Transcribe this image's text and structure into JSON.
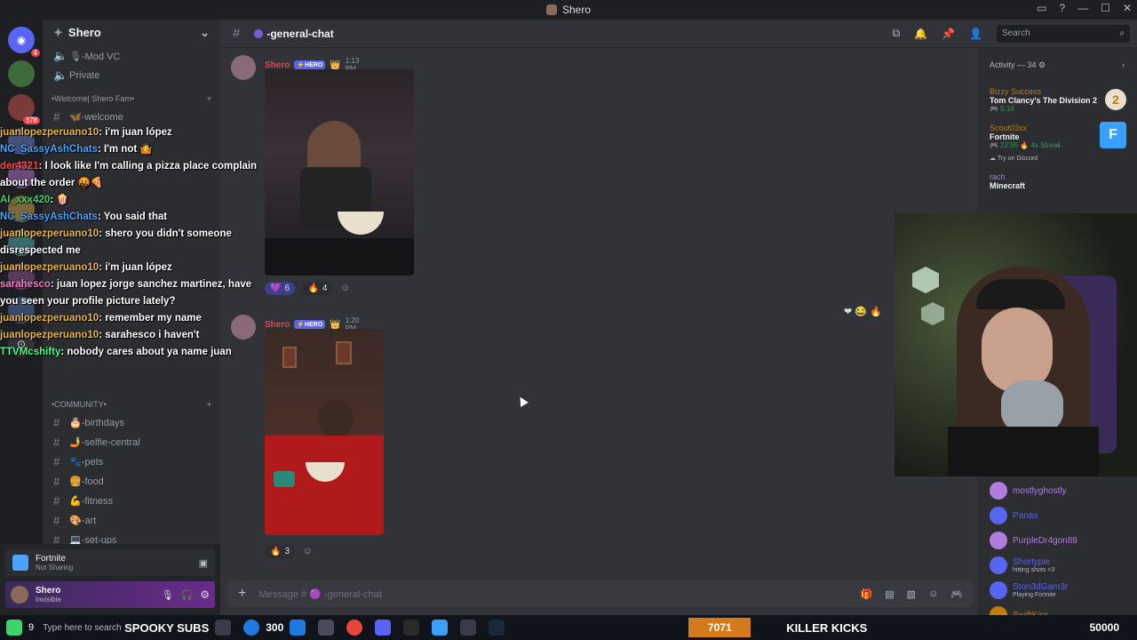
{
  "window": {
    "title": "Shero"
  },
  "server": {
    "name": "Shero"
  },
  "channels_top": [
    {
      "icon": "speaker-icon",
      "label": "🎙-Mod VC"
    },
    {
      "icon": "speaker-icon",
      "label": "Private"
    }
  ],
  "categories": {
    "welcome": "•Welcome| Shero Fam•",
    "community": "•COMMUNITY•"
  },
  "channels_welcome": [
    "🦋-welcome"
  ],
  "channels_community": [
    "🎂-birthdays",
    "🤳-selfie-central",
    "🐾-pets",
    "🍔-food",
    "💪-fitness",
    "🎨-art",
    "💻-set-ups"
  ],
  "topbar": {
    "channel": "-general-chat",
    "search_placeholder": "Search"
  },
  "messages": [
    {
      "author": "Shero",
      "badge": "⚡HERO",
      "time": "1:13 PM",
      "reactions": [
        {
          "emoji": "💜",
          "count": "6"
        },
        {
          "emoji": "🔥",
          "count": "4"
        }
      ]
    },
    {
      "author": "Shero",
      "badge": "⚡HERO",
      "time": "1:20 PM",
      "reactions": [
        {
          "emoji": "🔥",
          "count": "3"
        }
      ]
    }
  ],
  "composer": {
    "placeholder": "Message # 🟣 -general-chat"
  },
  "activity": {
    "header": "Activity — 34 ⚙",
    "items": [
      {
        "name": "Bizzy Success",
        "game": "Tom Clancy's The Division 2",
        "stat": "🎮 5:14"
      },
      {
        "name": "Scout03xx",
        "game": "Fortnite",
        "stat": "🎮 22:55 🔥 4x Streak",
        "extra": "☁ Try on Discord"
      },
      {
        "name": "rach",
        "game": "Minecraft"
      }
    ],
    "members": [
      {
        "name": "mostlyghostly",
        "color": "#b07ce0"
      },
      {
        "name": "Panas",
        "color": "#5865f2"
      },
      {
        "name": "PurpleDr4gon89",
        "color": "#b07ce0"
      },
      {
        "name": "Shortypie",
        "color": "#5865f2",
        "sub": "hitting shots <3"
      },
      {
        "name": "Ston3dGam3r",
        "color": "#5865f2",
        "sub": "Playing Fortnite"
      },
      {
        "name": "SwiftKiss",
        "color": "#c27c0e"
      }
    ]
  },
  "user_panel": {
    "activity_game": "Fortnite",
    "activity_status": "Not Sharing",
    "username": "Shero",
    "user_status": "Invisible"
  },
  "chat_overlay": [
    {
      "user": "juanlopezperuano10",
      "user_color": "#e8b64b",
      "text": ": i'm juan lópez"
    },
    {
      "user": "NC_SassyAshChats",
      "user_color": "#4aa3ff",
      "text": ": I'm not 🤷"
    },
    {
      "user": "der4321",
      "user_color": "#ff4a4a",
      "text": ": I look like I'm calling a pizza place complain about the order 🤬🍕"
    },
    {
      "user": "AI_xxx420",
      "user_color": "#3fd46a",
      "text": ": 🍿"
    },
    {
      "user": "NC_SassyAshChats",
      "user_color": "#4aa3ff",
      "text": ": You said that"
    },
    {
      "user": "juanlopezperuano10",
      "user_color": "#e8b64b",
      "text": ": shero you didn't someone disrespected me"
    },
    {
      "user": "juanlopezperuano10",
      "user_color": "#e8b64b",
      "text": ": i'm juan lópez"
    },
    {
      "user": "sarahesco",
      "user_color": "#ff7bd5",
      "text": ": juan lopez jorge sanchez martinez, have you seen your profile picture lately?"
    },
    {
      "user": "juanlopezperuano10",
      "user_color": "#e8b64b",
      "text": ": remember my name"
    },
    {
      "user": "juanlopezperuano10",
      "user_color": "#e8b64b",
      "text": ": sarahesco i haven't"
    },
    {
      "user": "TTVMcshifty",
      "user_color": "#4aff8a",
      "text": ": nobody cares about ya name juan"
    }
  ],
  "taskbar": {
    "search_placeholder": "Type here to search",
    "spooky": "SPOOKY SUBS",
    "spooky_count": "300",
    "kicks_count": "7071",
    "killer": "KILLER KICKS",
    "killer_count": "50000"
  },
  "colors": {
    "accent": "#5865f2",
    "bg": "#313338",
    "sidebar": "#2b2d31"
  }
}
